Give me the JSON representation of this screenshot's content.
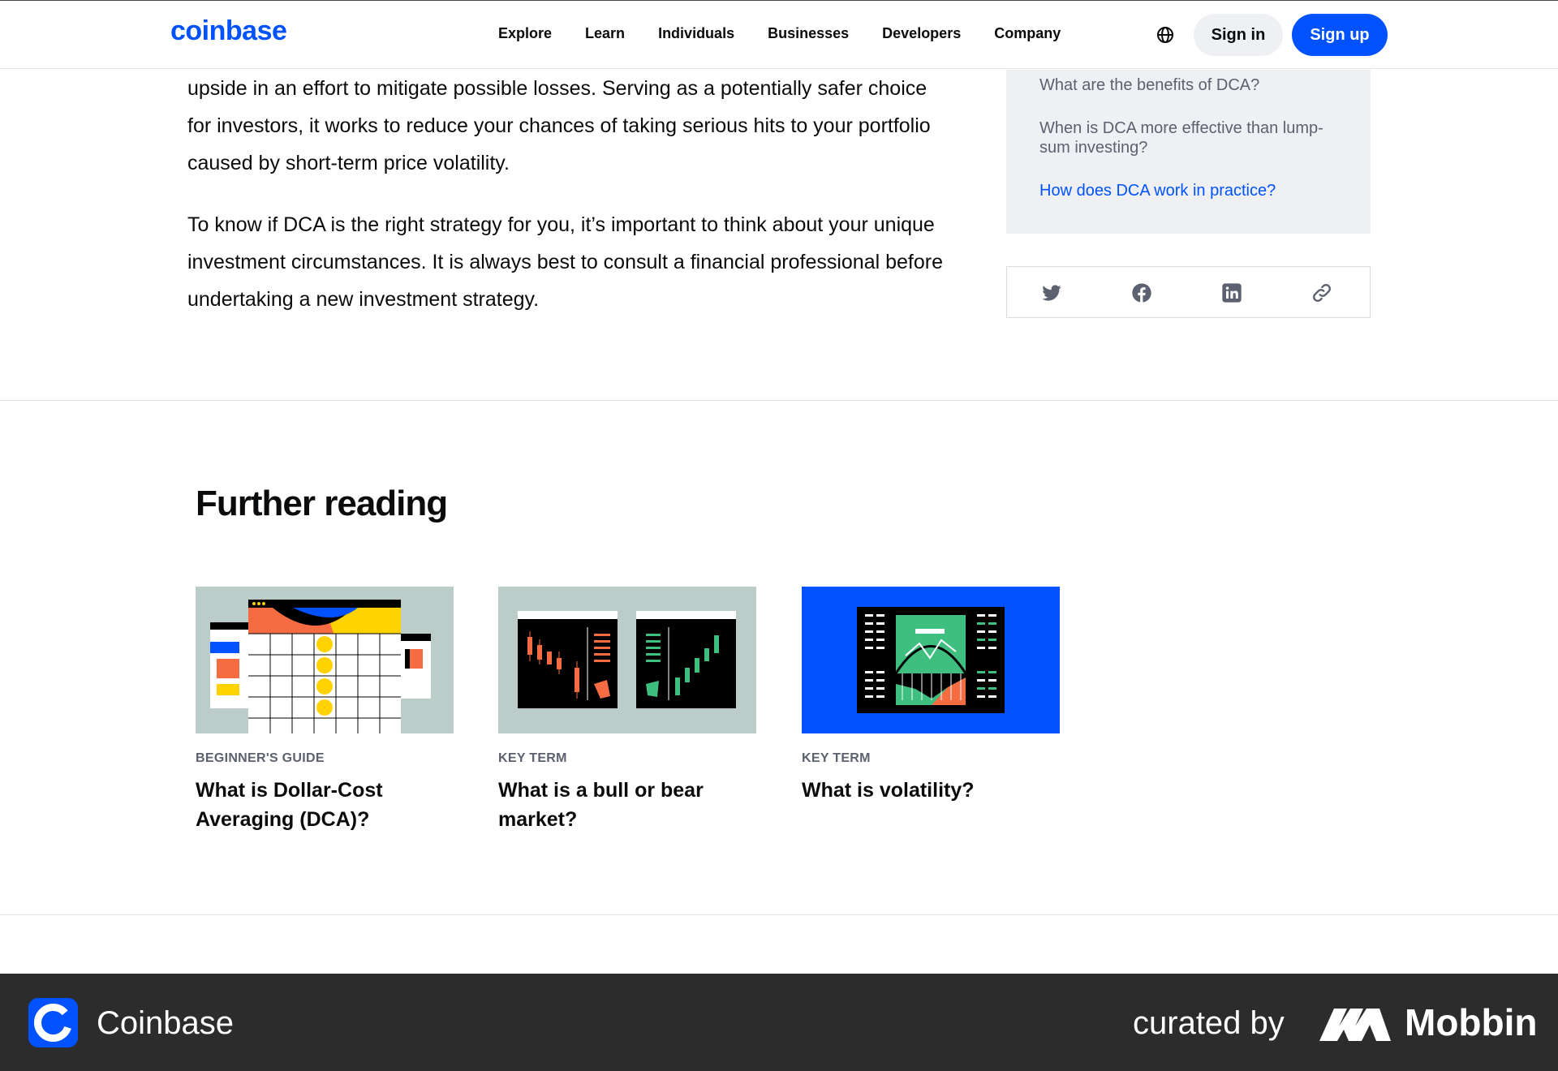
{
  "header": {
    "logo": "coinbase",
    "nav": [
      "Explore",
      "Learn",
      "Individuals",
      "Businesses",
      "Developers",
      "Company"
    ],
    "sign_in": "Sign in",
    "sign_up": "Sign up",
    "icons": {
      "language": "globe-icon"
    }
  },
  "article": {
    "paragraphs": [
      "upside in an effort to mitigate possible losses. Serving as a potentially safer choice for investors, it works to reduce your chances of taking serious hits to your portfolio caused by short-term price volatility.",
      "To know if DCA is the right strategy for you, it’s important to think about your unique investment circumstances. It is always best to consult a financial professional before undertaking a new investment strategy."
    ]
  },
  "toc": {
    "items": [
      {
        "label": "What are the benefits of DCA?",
        "active": false
      },
      {
        "label": "When is DCA more effective than lump-sum investing?",
        "active": false
      },
      {
        "label": "How does DCA work in practice?",
        "active": true
      }
    ]
  },
  "share": {
    "icons": [
      "twitter-icon",
      "facebook-icon",
      "linkedin-icon",
      "link-icon"
    ]
  },
  "further_reading": {
    "title": "Further reading",
    "cards": [
      {
        "eyebrow": "BEGINNER'S GUIDE",
        "title": "What is Dollar-Cost Averaging (DCA)?"
      },
      {
        "eyebrow": "KEY TERM",
        "title": "What is a bull or bear market?"
      },
      {
        "eyebrow": "KEY TERM",
        "title": "What is volatility?"
      }
    ]
  },
  "footer": {
    "app_name": "Coinbase",
    "curated_by": "curated by",
    "brand": "Mobbin"
  },
  "colors": {
    "brand_blue": "#0052ff",
    "text": "#0a0b0d",
    "muted": "#5b616e",
    "toc_bg": "#eef0f3",
    "footer_bg": "#2c2c2c"
  }
}
